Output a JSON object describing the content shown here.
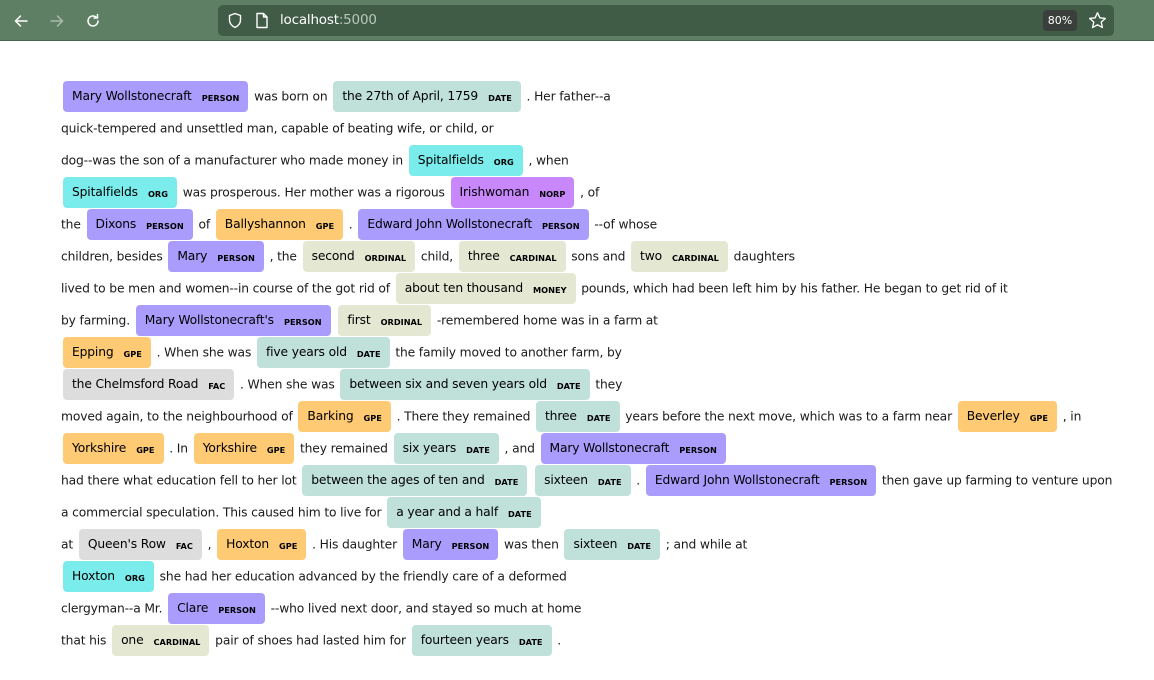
{
  "browser": {
    "url_host": "localhost",
    "url_port": ":5000",
    "zoom_level": "80%",
    "icons": [
      "back-arrow-icon",
      "forward-arrow-icon",
      "reload-icon",
      "shield-icon",
      "page-icon",
      "star-icon"
    ]
  },
  "entity_colors": {
    "PERSON": "#aa9cfc",
    "DATE": "#bfe1d9",
    "ORG": "#7aecec",
    "NORP": "#c887fb",
    "GPE": "#feca74",
    "FAC": "#dddddd",
    "ORDINAL": "#e4e7d2",
    "CARDINAL": "#e4e7d2",
    "MONEY": "#e4e7d2"
  },
  "lines": [
    [
      {
        "e": "Mary Wollstonecraft",
        "l": "PERSON"
      },
      {
        "t": " was born on "
      },
      {
        "e": "the 27th of April, 1759",
        "l": "DATE"
      },
      {
        "t": " . Her father--a"
      }
    ],
    [
      {
        "t": "quick-tempered and unsettled man, capable of beating wife, or child, or"
      }
    ],
    [
      {
        "t": "dog--was the son of a manufacturer who made money in "
      },
      {
        "e": "Spitalfields",
        "l": "ORG"
      },
      {
        "t": " , when"
      }
    ],
    [
      {
        "e": "Spitalfields",
        "l": "ORG"
      },
      {
        "t": " was prosperous. Her mother was a rigorous "
      },
      {
        "e": "Irishwoman",
        "l": "NORP"
      },
      {
        "t": " , of"
      }
    ],
    [
      {
        "t": "the "
      },
      {
        "e": "Dixons",
        "l": "PERSON"
      },
      {
        "t": " of "
      },
      {
        "e": "Ballyshannon",
        "l": "GPE"
      },
      {
        "t": " . "
      },
      {
        "e": "Edward John Wollstonecraft",
        "l": "PERSON"
      },
      {
        "t": " --of whose"
      }
    ],
    [
      {
        "t": "children, besides "
      },
      {
        "e": "Mary",
        "l": "PERSON"
      },
      {
        "t": " , the "
      },
      {
        "e": "second",
        "l": "ORDINAL"
      },
      {
        "t": " child, "
      },
      {
        "e": "three",
        "l": "CARDINAL"
      },
      {
        "t": " sons and "
      },
      {
        "e": "two",
        "l": "CARDINAL"
      },
      {
        "t": " daughters"
      }
    ],
    [
      {
        "t": "lived to be men and women--in course of the got rid of "
      },
      {
        "e": "about ten thousand",
        "l": "MONEY"
      },
      {
        "t": " pounds, which had been left him by his father. He began to get rid of it"
      }
    ],
    [
      {
        "t": "by farming. "
      },
      {
        "e": "Mary Wollstonecraft's",
        "l": "PERSON"
      },
      {
        "t": " "
      },
      {
        "e": "first",
        "l": "ORDINAL"
      },
      {
        "t": " -remembered home was in a farm at"
      }
    ],
    [
      {
        "e": "Epping",
        "l": "GPE"
      },
      {
        "t": " . When she was "
      },
      {
        "e": "five years old",
        "l": "DATE"
      },
      {
        "t": " the family moved to another farm, by"
      }
    ],
    [
      {
        "e": "the Chelmsford Road",
        "l": "FAC"
      },
      {
        "t": " . When she was "
      },
      {
        "e": "between six and seven years old",
        "l": "DATE"
      },
      {
        "t": " they"
      }
    ],
    [
      {
        "t": "moved again, to the neighbourhood of "
      },
      {
        "e": "Barking",
        "l": "GPE"
      },
      {
        "t": " . There they remained "
      },
      {
        "e": "three",
        "l": "DATE"
      },
      {
        "t": " years before the next move, which was to a farm near "
      },
      {
        "e": "Beverley",
        "l": "GPE"
      },
      {
        "t": " , in"
      }
    ],
    [
      {
        "e": "Yorkshire",
        "l": "GPE"
      },
      {
        "t": " . In "
      },
      {
        "e": "Yorkshire",
        "l": "GPE"
      },
      {
        "t": " they remained "
      },
      {
        "e": "six years",
        "l": "DATE"
      },
      {
        "t": " , and "
      },
      {
        "e": "Mary Wollstonecraft",
        "l": "PERSON"
      }
    ],
    [
      {
        "t": "had there what education fell to her lot "
      },
      {
        "e": "between the ages of ten and",
        "l": "DATE"
      },
      {
        "t": " "
      },
      {
        "e": "sixteen",
        "l": "DATE"
      },
      {
        "t": " . "
      },
      {
        "e": "Edward John Wollstonecraft",
        "l": "PERSON"
      },
      {
        "t": " then gave up farming to venture upon"
      }
    ],
    [
      {
        "t": "a commercial speculation. This caused him to live for "
      },
      {
        "e": "a year and a half",
        "l": "DATE"
      }
    ],
    [
      {
        "t": "at "
      },
      {
        "e": "Queen's Row",
        "l": "FAC"
      },
      {
        "t": " , "
      },
      {
        "e": "Hoxton",
        "l": "GPE"
      },
      {
        "t": " . His daughter "
      },
      {
        "e": "Mary",
        "l": "PERSON"
      },
      {
        "t": " was then "
      },
      {
        "e": "sixteen",
        "l": "DATE"
      },
      {
        "t": " ; and while at"
      }
    ],
    [
      {
        "e": "Hoxton",
        "l": "ORG"
      },
      {
        "t": " she had her education advanced by the friendly care of a deformed"
      }
    ],
    [
      {
        "t": "clergyman--a Mr. "
      },
      {
        "e": "Clare",
        "l": "PERSON"
      },
      {
        "t": " --who lived next door, and stayed so much at home"
      }
    ],
    [
      {
        "t": "that his "
      },
      {
        "e": "one",
        "l": "CARDINAL"
      },
      {
        "t": " pair of shoes had lasted him for "
      },
      {
        "e": "fourteen years",
        "l": "DATE"
      },
      {
        "t": " ."
      }
    ]
  ]
}
